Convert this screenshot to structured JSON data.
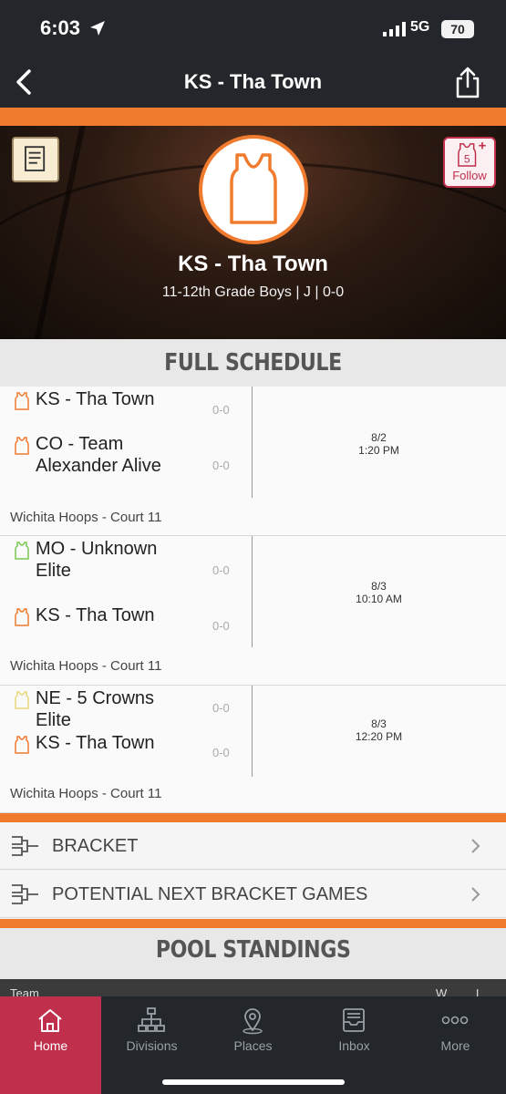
{
  "status": {
    "time": "6:03",
    "network": "5G",
    "battery": "70"
  },
  "nav": {
    "title": "KS - Tha Town"
  },
  "header": {
    "team_name": "KS - Tha Town",
    "subtitle": "11-12th Grade Boys | J | 0-0",
    "follow_label": "Follow",
    "follow_count": "5"
  },
  "schedule": {
    "title": "FULL SCHEDULE",
    "games": [
      {
        "team1": "KS - Tha Town",
        "team1_color": "#f07b2e",
        "score1": "0-0",
        "team2": "CO - Team Alexander Alive",
        "team2_color": "#f07b2e",
        "score2": "0-0",
        "date": "8/2",
        "time": "1:20 PM",
        "court": "Wichita Hoops - Court 11"
      },
      {
        "team1": "MO - Unknown Elite",
        "team1_color": "#7ac74f",
        "score1": "0-0",
        "team2": "KS - Tha Town",
        "team2_color": "#f07b2e",
        "score2": "0-0",
        "date": "8/3",
        "time": "10:10 AM",
        "court": "Wichita Hoops - Court 11"
      },
      {
        "team1": "NE - 5 Crowns Elite",
        "team1_color": "#f0e08a",
        "score1": "0-0",
        "team2": "KS - Tha Town",
        "team2_color": "#f07b2e",
        "score2": "0-0",
        "date": "8/3",
        "time": "12:20 PM",
        "court": "Wichita Hoops - Court 11"
      }
    ]
  },
  "links": {
    "bracket": "BRACKET",
    "next_bracket": "POTENTIAL NEXT BRACKET GAMES"
  },
  "standings": {
    "title": "POOL STANDINGS",
    "col_team": "Team",
    "col_w": "W",
    "col_l": "L"
  },
  "tabs": [
    {
      "label": "Home",
      "icon": "home-icon"
    },
    {
      "label": "Divisions",
      "icon": "divisions-icon"
    },
    {
      "label": "Places",
      "icon": "places-icon"
    },
    {
      "label": "Inbox",
      "icon": "inbox-icon"
    },
    {
      "label": "More",
      "icon": "more-icon"
    }
  ],
  "colors": {
    "accent": "#f07b2e",
    "active_tab": "#c0304d",
    "dark": "#23272b"
  }
}
